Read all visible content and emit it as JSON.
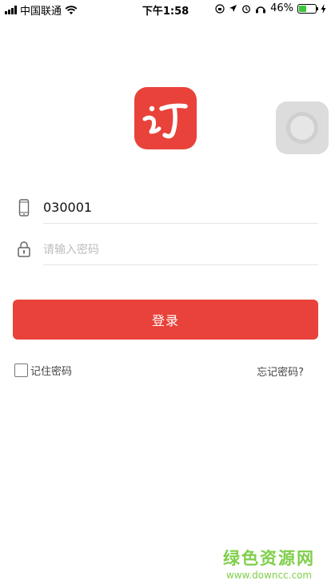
{
  "status_bar": {
    "carrier": "中国联通",
    "time": "下午1:58",
    "battery_percent": "46%",
    "battery_level": 0.46
  },
  "login": {
    "username_value": "030001",
    "password_placeholder": "请输入密码",
    "login_button_label": "登录",
    "remember_label": "记住密码",
    "forgot_label": "忘记密码?"
  },
  "watermark": {
    "title": "绿色资源网",
    "url": "www.downcc.com"
  },
  "colors": {
    "accent": "#e8423a",
    "battery_green": "#3bc63b",
    "watermark_green": "#7fcf4a"
  },
  "icons": [
    "signal-icon",
    "wifi-icon",
    "location-icon",
    "alarm-icon",
    "headphones-icon",
    "battery-icon",
    "charging-icon",
    "phone-icon",
    "lock-icon"
  ]
}
